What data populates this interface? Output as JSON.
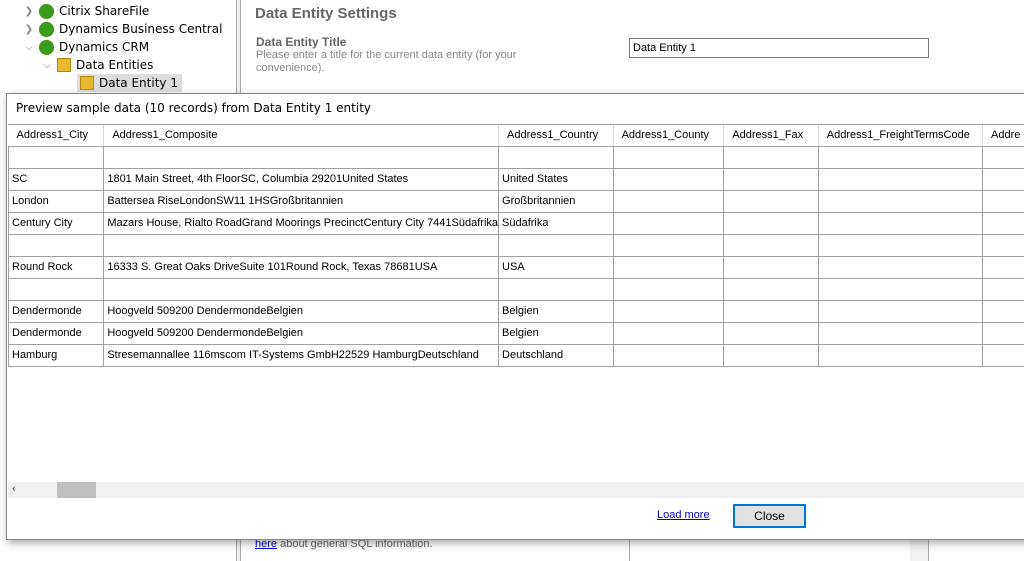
{
  "tree": {
    "items": [
      {
        "label": "Citrix ShareFile",
        "expanded": false,
        "icon": "plugin-icon"
      },
      {
        "label": "Dynamics Business Central",
        "expanded": false,
        "icon": "plugin-icon"
      },
      {
        "label": "Dynamics CRM",
        "expanded": true,
        "icon": "plugin-icon"
      },
      {
        "label": "Data Entities",
        "expanded": true,
        "icon": "folder-icon"
      },
      {
        "label": "Data Entity 1",
        "selected": true,
        "icon": "entity-icon"
      }
    ]
  },
  "settings": {
    "heading": "Data Entity Settings",
    "title_label": "Data Entity Title",
    "title_desc": "Please enter a title for the current data entity (for your convenience).",
    "title_value": "Data Entity 1",
    "bottom_link": "here",
    "bottom_text": " about general SQL information."
  },
  "dialog": {
    "title": "Preview sample data (10 records) from Data Entity 1 entity",
    "columns": [
      "Address1_City",
      "Address1_Composite",
      "Address1_Country",
      "Address1_County",
      "Address1_Fax",
      "Address1_FreightTermsCode",
      "Addre"
    ],
    "rows": [
      [
        "",
        "",
        "",
        "",
        "",
        "",
        ""
      ],
      [
        "SC",
        "1801 Main Street, 4th FloorSC, Columbia 29201United States",
        "United States",
        "",
        "",
        "",
        ""
      ],
      [
        "London",
        "Battersea RiseLondonSW11 1HSGroßbritannien",
        "Großbritannien",
        "",
        "",
        "",
        ""
      ],
      [
        "Century City",
        "Mazars House, Rialto RoadGrand Moorings PrecinctCentury City 7441Südafrika",
        "Südafrika",
        "",
        "",
        "",
        ""
      ],
      [
        "",
        "",
        "",
        "",
        "",
        "",
        ""
      ],
      [
        "Round Rock",
        "16333 S. Great Oaks DriveSuite 101Round Rock, Texas 78681USA",
        "USA",
        "",
        "",
        "",
        ""
      ],
      [
        "",
        "",
        "",
        "",
        "",
        "",
        ""
      ],
      [
        "Dendermonde",
        "Hoogveld 509200 DendermondeBelgien",
        "Belgien",
        "",
        "",
        "",
        ""
      ],
      [
        "Dendermonde",
        "Hoogveld 509200 DendermondeBelgien",
        "Belgien",
        "",
        "",
        "",
        ""
      ],
      [
        "Hamburg",
        "Stresemannallee 116mscom IT-Systems GmbH22529 HamburgDeutschland",
        "Deutschland",
        "",
        "",
        "",
        ""
      ]
    ],
    "scroll_left_arrow": "‹",
    "load_more": "Load more",
    "close": "Close"
  }
}
